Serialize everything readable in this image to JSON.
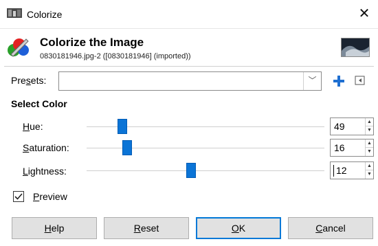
{
  "window": {
    "title": "Colorize"
  },
  "header": {
    "title": "Colorize the Image",
    "subtitle": "0830181946.jpg-2 ([0830181946] (imported))"
  },
  "presets": {
    "label_pre": "Pre",
    "label_mn": "s",
    "label_post": "ets:",
    "value": ""
  },
  "section": {
    "title": "Select Color"
  },
  "hue": {
    "label_mn": "H",
    "label_rest": "ue:",
    "value": "49",
    "fraction": 0.15
  },
  "saturation": {
    "label_mn": "S",
    "label_rest": "aturation:",
    "value": "16",
    "fraction": 0.17
  },
  "lightness": {
    "label_mn": "L",
    "label_rest": "ightness:",
    "value": "12",
    "fraction": 0.44
  },
  "preview": {
    "label_mn": "P",
    "label_rest": "review",
    "checked": true
  },
  "buttons": {
    "help_mn": "H",
    "help_rest": "elp",
    "reset_mn": "R",
    "reset_rest": "eset",
    "ok_mn": "O",
    "ok_rest": "K",
    "cancel_mn": "C",
    "cancel_rest": "ancel"
  },
  "colors": {
    "accent": "#0b74d6",
    "ok_border": "#0078d7"
  }
}
